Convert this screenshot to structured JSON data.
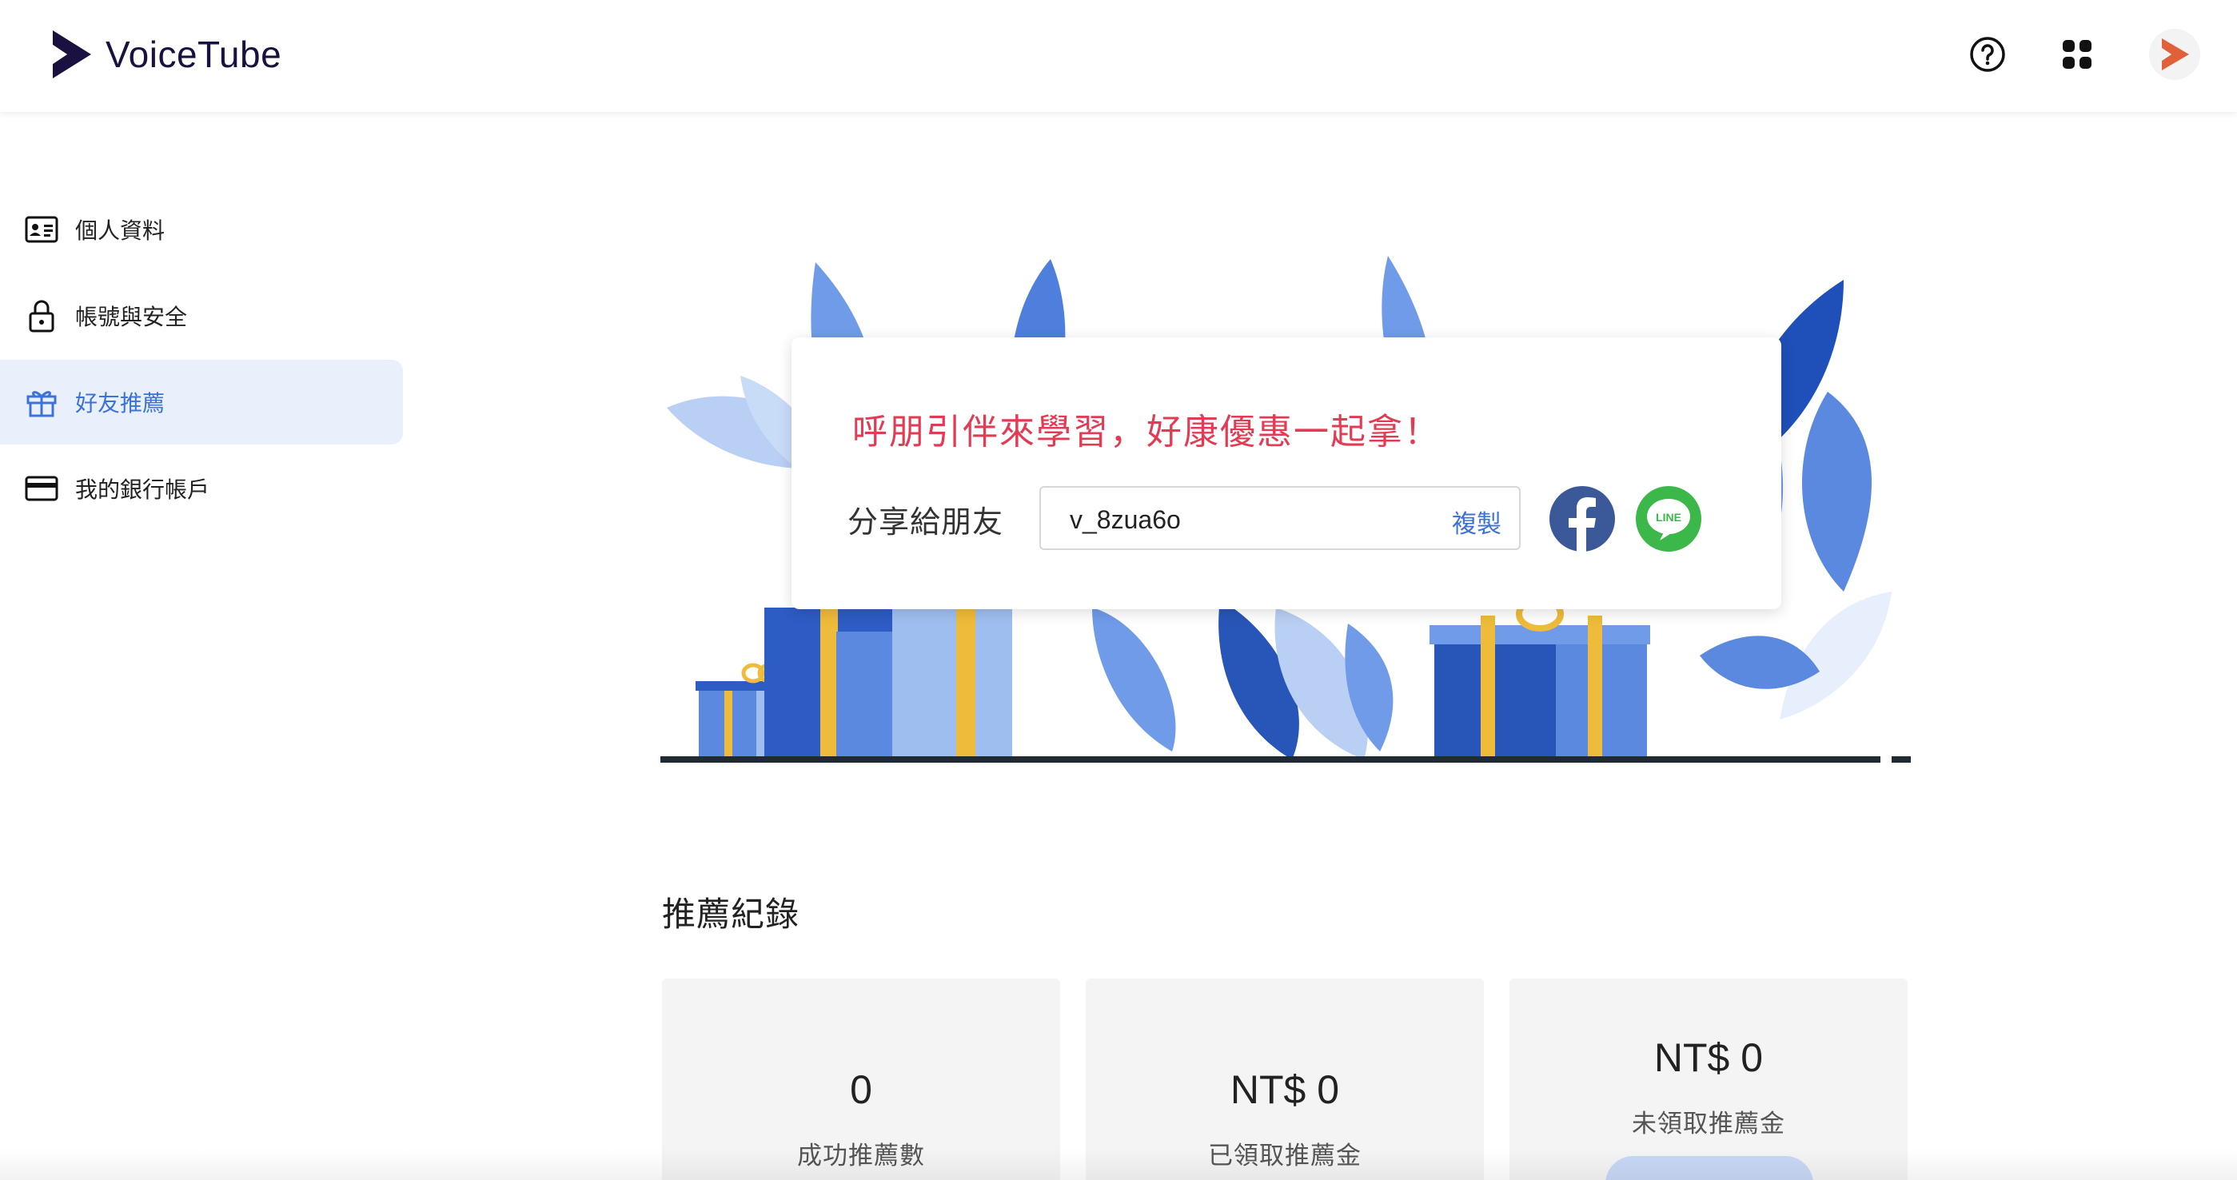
{
  "header": {
    "brand": "VoiceTube",
    "help_icon": "question-circle-icon",
    "apps_icon": "grid-apps-icon",
    "avatar_icon": "voicetube-play-icon"
  },
  "sidebar": {
    "items": [
      {
        "label": "個人資料",
        "icon": "id-card-icon"
      },
      {
        "label": "帳號與安全",
        "icon": "lock-icon"
      },
      {
        "label": "好友推薦",
        "icon": "gift-icon"
      },
      {
        "label": "我的銀行帳戶",
        "icon": "credit-card-icon"
      }
    ],
    "active_index": 2
  },
  "share": {
    "promo_title": "呼朋引伴來學習，好康優惠一起拿！",
    "label": "分享給朋友",
    "code": "v_8zua6o",
    "copy_label": "複製",
    "line_text": "LINE"
  },
  "records": {
    "title": "推薦紀錄",
    "stats": [
      {
        "value": "0",
        "label": "成功推薦數"
      },
      {
        "value": "NT$ 0",
        "label": "已領取推薦金"
      },
      {
        "value": "NT$ 0",
        "label": "未領取推薦金"
      }
    ]
  },
  "colors": {
    "accent": "#3d72d8",
    "promo": "#e23c55",
    "active_bg": "#eaf0fb",
    "facebook": "#3b5998",
    "line": "#3cb84a"
  }
}
